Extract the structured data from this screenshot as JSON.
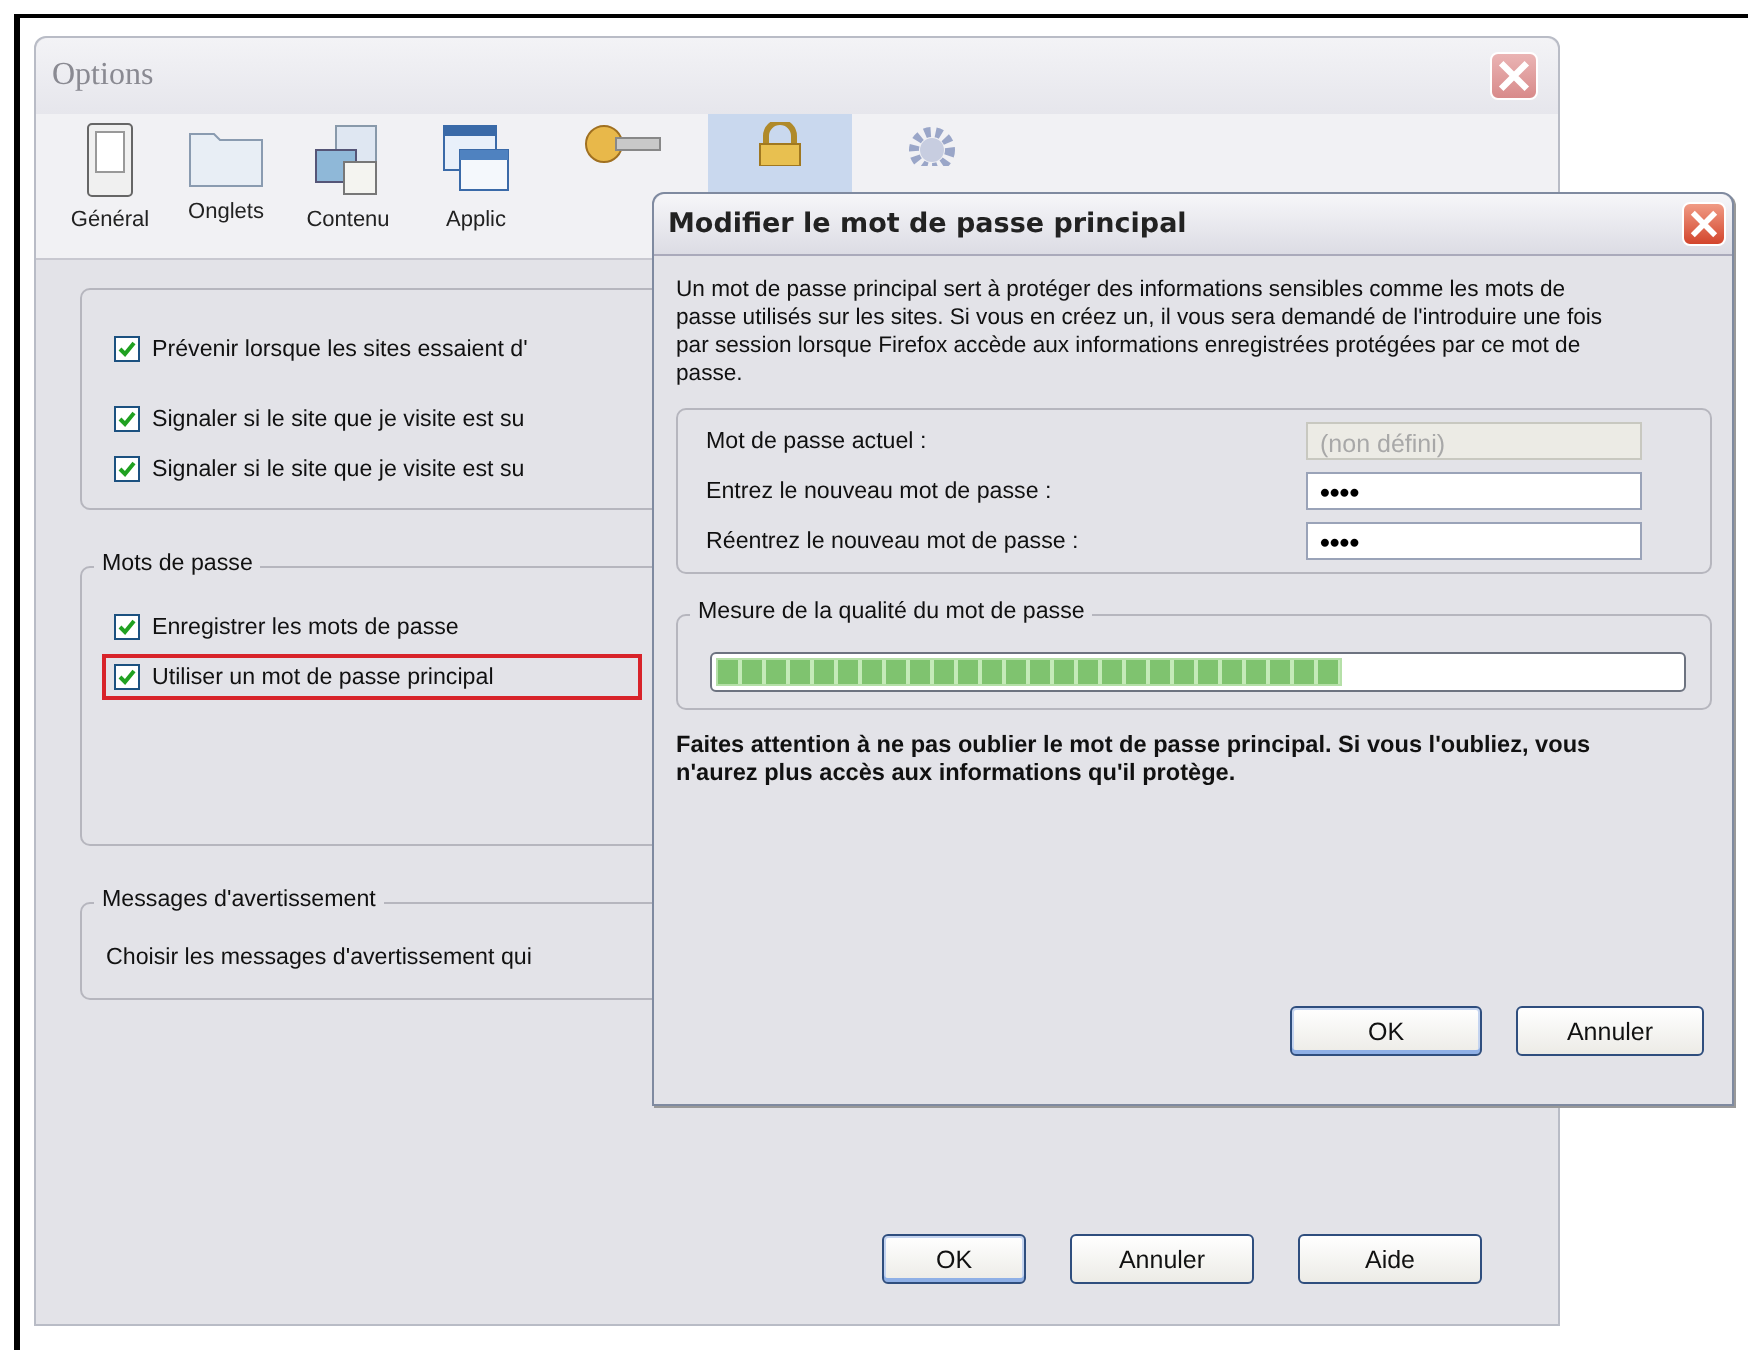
{
  "window": {
    "title": "Options"
  },
  "toolbar": [
    {
      "label": "Général",
      "kind": "switch",
      "selected": false
    },
    {
      "label": "Onglets",
      "kind": "folder",
      "selected": false
    },
    {
      "label": "Contenu",
      "kind": "content",
      "selected": false
    },
    {
      "label": "Applic",
      "kind": "apps",
      "selected": false
    },
    {
      "kind": "key",
      "selected": false
    },
    {
      "kind": "lock",
      "selected": true
    },
    {
      "kind": "gear",
      "selected": false
    }
  ],
  "groups": [
    {
      "items": [
        {
          "label": "Prévenir lorsque les sites essaient d'",
          "checked": true,
          "highlighted": false
        },
        {
          "label": "Signaler si le site que je visite est su",
          "checked": true,
          "highlighted": false
        },
        {
          "label": "Signaler si le site que je visite est su",
          "checked": true,
          "highlighted": false
        }
      ]
    },
    {
      "legend": "Mots de passe",
      "items": [
        {
          "label": "Enregistrer les mots de passe",
          "checked": true,
          "highlighted": false
        },
        {
          "label": "Utiliser un mot de passe principal",
          "checked": true,
          "highlighted": true
        }
      ]
    },
    {
      "legend": "Messages d'avertissement",
      "text": "Choisir les messages d'avertissement qui"
    }
  ],
  "buttons": [
    "OK",
    "Annuler",
    "Aide"
  ],
  "dialog": {
    "title": "Modifier le mot de passe principal",
    "description": "Un mot de passe principal sert à protéger des informations sensibles comme les mots de passe utilisés sur les sites. Si vous en créez un, il vous sera demandé de l'introduire une fois par session lorsque Firefox accède aux informations enregistrées protégées par ce mot de passe.",
    "fields": [
      {
        "label": "Mot de passe actuel :",
        "placeholder": "(non défini)",
        "disabled": true
      },
      {
        "label": "Entrez le nouveau mot de passe :",
        "value": "••••",
        "disabled": false
      },
      {
        "label": "Réentrez le nouveau mot de passe :",
        "value": "••••",
        "disabled": false
      }
    ],
    "quality": {
      "legend": "Mesure de la qualité du mot de passe",
      "level": 0.65
    },
    "warning": "Faites attention à ne pas oublier le mot de passe principal. Si vous l'oubliez, vous n'aurez plus accès aux informations qu'il protège.",
    "buttons": [
      "OK",
      "Annuler"
    ]
  }
}
